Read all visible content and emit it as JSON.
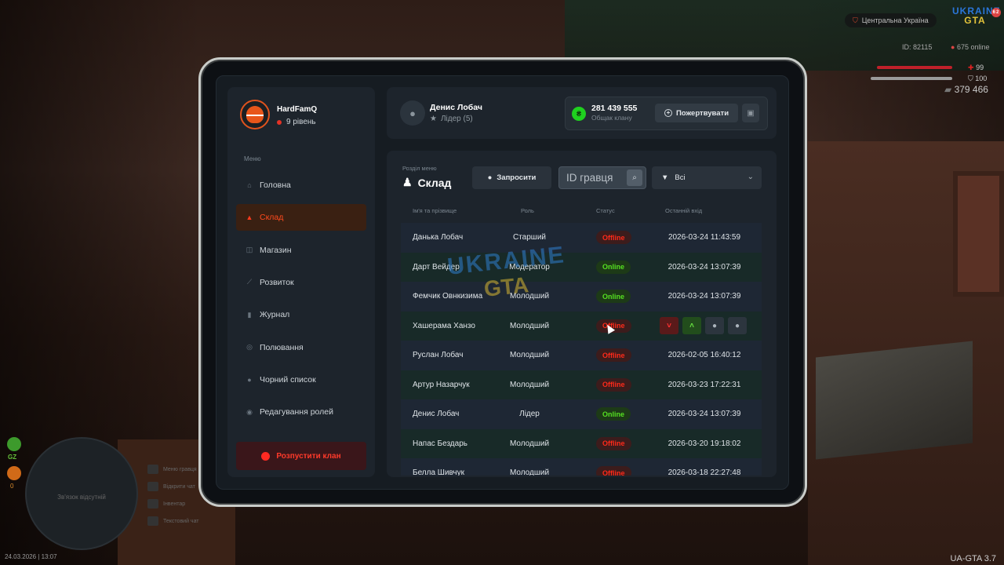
{
  "hud": {
    "region": "Центральна Україна",
    "logo_top": "UKRAINE",
    "logo_bottom": "GTA",
    "logo_badge": "62",
    "player_id": "ID: 82115",
    "online": "675 online",
    "health": "99",
    "armor": "100",
    "money": "379 466",
    "version": "UA-GTA 3.7",
    "gz_label": "GZ",
    "gz2_label": "0",
    "minimap_text": "Зв'язок відсутній",
    "date": "24.03.2026 | 13:07",
    "chat_menu": [
      "Меню гравця",
      "Відкрити чат",
      "Інвентар",
      "Текстовий чат"
    ]
  },
  "sidebar": {
    "profile_name": "HardFamQ",
    "profile_level": "9 рівень",
    "menu_label": "Меню",
    "items": [
      {
        "label": "Головна",
        "icon": "⌂"
      },
      {
        "label": "Склад",
        "icon": "▲"
      },
      {
        "label": "Магазин",
        "icon": "◫"
      },
      {
        "label": "Розвиток",
        "icon": "⟋"
      },
      {
        "label": "Журнал",
        "icon": "▮"
      },
      {
        "label": "Полювання",
        "icon": "◎"
      },
      {
        "label": "Чорний список",
        "icon": "●"
      },
      {
        "label": "Редагування ролей",
        "icon": "◉"
      }
    ],
    "active_index": 1,
    "disband_label": "Розпустити клан"
  },
  "header": {
    "leader_name": "Денис Лобач",
    "leader_role": "Лідер (5)",
    "treasury_amount": "281 439 555",
    "treasury_label": "Общак клану",
    "donate_label": "Пожертвувати"
  },
  "main": {
    "section_label": "Розділ меню",
    "section_title": "Склад",
    "invite_label": "Запросити",
    "search_placeholder": "ID гравця",
    "filter_value": "Всі",
    "columns": [
      "Ім'я та прізвище",
      "Роль",
      "Статус",
      "Останній вхід"
    ],
    "rows": [
      {
        "name": "Данька Лобач",
        "role": "Старший",
        "status": "Offline",
        "last": "2026-03-24 11:43:59"
      },
      {
        "name": "Дарт Вейдер",
        "role": "Модератор",
        "status": "Online",
        "last": "2026-03-24 13:07:39"
      },
      {
        "name": "Фемчик Овнкизима",
        "role": "Молодший",
        "status": "Online",
        "last": "2026-03-24 13:07:39"
      },
      {
        "name": "Хашерама Ханзо",
        "role": "Молодший",
        "status": "Offline",
        "last": ""
      },
      {
        "name": "Руслан Лобач",
        "role": "Молодший",
        "status": "Offline",
        "last": "2026-02-05 16:40:12"
      },
      {
        "name": "Артур Назарчук",
        "role": "Молодший",
        "status": "Offline",
        "last": "2026-03-23 17:22:31"
      },
      {
        "name": "Денис Лобач",
        "role": "Лідер",
        "status": "Online",
        "last": "2026-03-24 13:07:39"
      },
      {
        "name": "Напас Бездарь",
        "role": "Молодший",
        "status": "Offline",
        "last": "2026-03-20 19:18:02"
      },
      {
        "name": "Белла Шивчук",
        "role": "Молодший",
        "status": "Offline",
        "last": "2026-03-18 22:27:48"
      }
    ],
    "hover_row_index": 3,
    "watermark_top": "UKRAINE",
    "watermark_bottom": "GTA"
  },
  "colors": {
    "accent": "#ff3a1d",
    "online": "#55e021",
    "offline": "#ff2a1a",
    "treasury_coin": "#1fd11f"
  }
}
